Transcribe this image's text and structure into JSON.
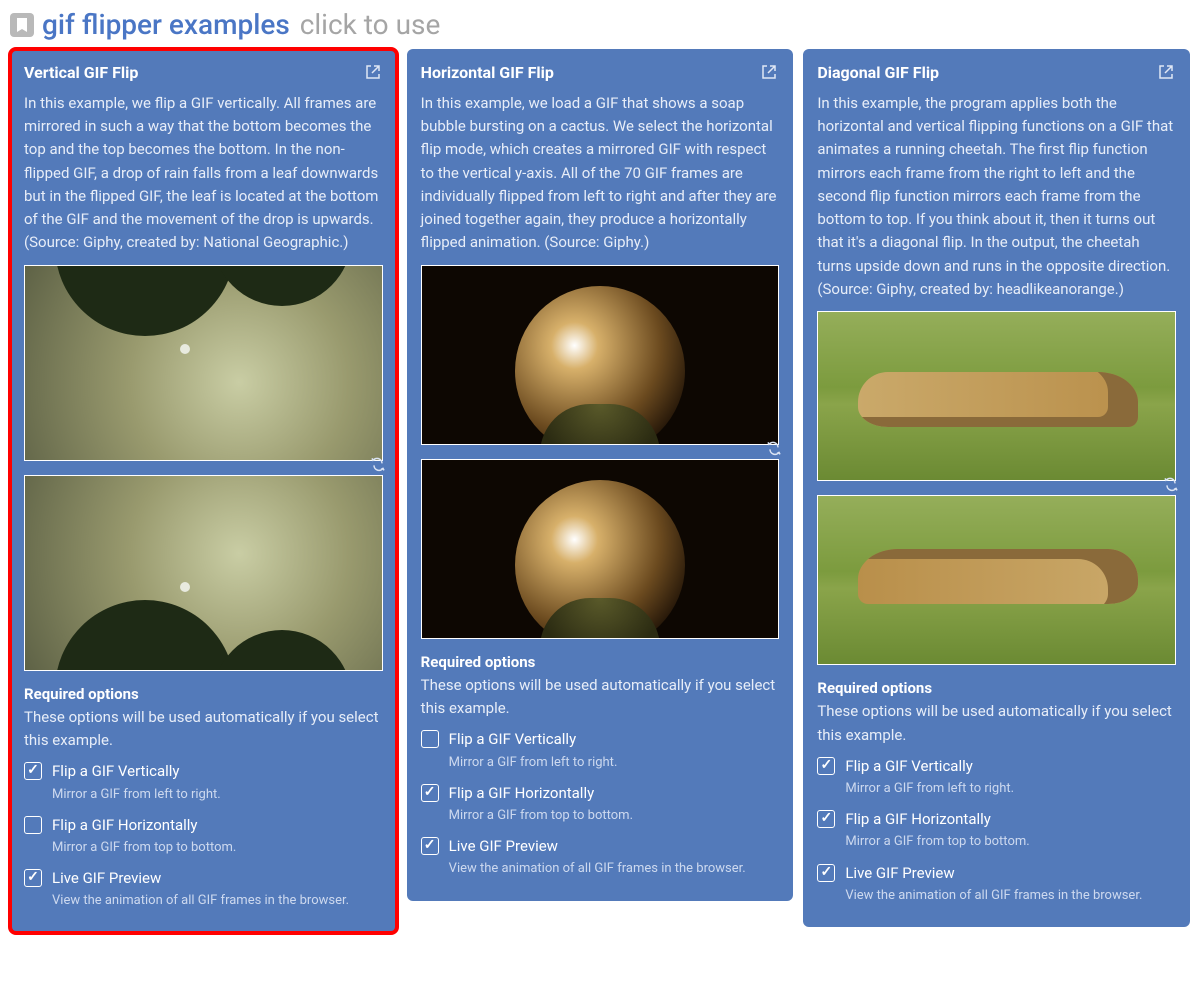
{
  "header": {
    "title": "gif flipper examples",
    "subtitle": "click to use"
  },
  "required_options_heading": "Required options",
  "required_options_desc": "These options will be used automatically if you select this example.",
  "option_labels": {
    "vert": "Flip a GIF Vertically",
    "vert_sub": "Mirror a GIF from left to right.",
    "horiz": "Flip a GIF Horizontally",
    "horiz_sub": "Mirror a GIF from top to bottom.",
    "live": "Live GIF Preview",
    "live_sub": "View the animation of all GIF frames in the browser."
  },
  "cards": [
    {
      "title": "Vertical GIF Flip",
      "desc": "In this example, we flip a GIF vertically. All frames are mirrored in such a way that the bottom becomes the top and the top becomes the bottom. In the non-flipped GIF, a drop of rain falls from a leaf downwards but in the flipped GIF, the leaf is located at the bottom of the GIF and the movement of the drop is upwards. (Source: Giphy, created by: National Geographic.)",
      "vert_checked": true,
      "horiz_checked": false,
      "live_checked": true
    },
    {
      "title": "Horizontal GIF Flip",
      "desc": "In this example, we load a GIF that shows a soap bubble bursting on a cactus. We select the horizontal flip mode, which creates a mirrored GIF with respect to the vertical y-axis. All of the 70 GIF frames are individually flipped from left to right and after they are joined together again, they produce a horizontally flipped animation. (Source: Giphy.)",
      "vert_checked": false,
      "horiz_checked": true,
      "live_checked": true
    },
    {
      "title": "Diagonal GIF Flip",
      "desc": "In this example, the program applies both the horizontal and vertical flipping functions on a GIF that animates a running cheetah. The first flip function mirrors each frame from the right to left and the second flip function mirrors each frame from the bottom to top. If you think about it, then it turns out that it's a diagonal flip. In the output, the cheetah turns upside down and runs in the opposite direction. (Source: Giphy, created by: headlikeanorange.)",
      "vert_checked": true,
      "horiz_checked": true,
      "live_checked": true
    }
  ]
}
